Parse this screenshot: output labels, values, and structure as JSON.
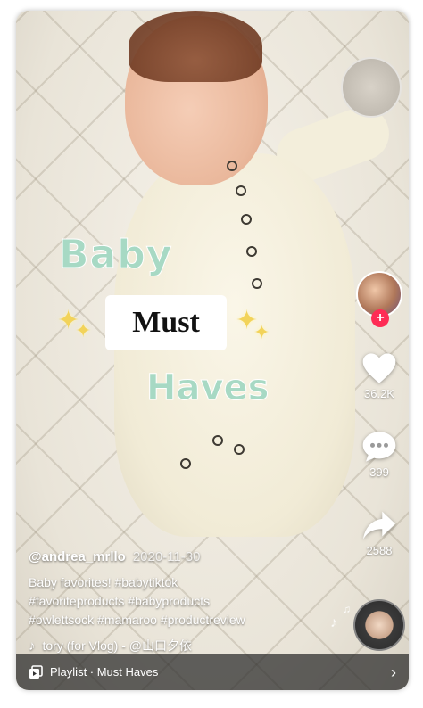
{
  "overlay_text": {
    "line1": "Baby",
    "line2": "Must",
    "line3": "Haves"
  },
  "side_actions": {
    "avatar_follow": "+",
    "like_count": "36.2K",
    "comment_count": "399",
    "share_count": "2588",
    "icons": [
      "heart-icon",
      "comment-icon",
      "share-icon"
    ]
  },
  "caption": {
    "author": "@andrea_mrllo",
    "date": "2020-11-30",
    "description_lines": [
      "Baby favorites! #babytiktok",
      "#favoriteproducts #babyproducts",
      "#owlettsock #mamaroo #productreview"
    ],
    "sound": "tory (for Vlog) - @山口夕依"
  },
  "playlist": {
    "label": "Playlist · Must Haves",
    "chevron": "›"
  },
  "colors": {
    "title_mint": "#a7d9c4",
    "follow_red": "#fe2c55",
    "playlist_bar": "#282828"
  }
}
